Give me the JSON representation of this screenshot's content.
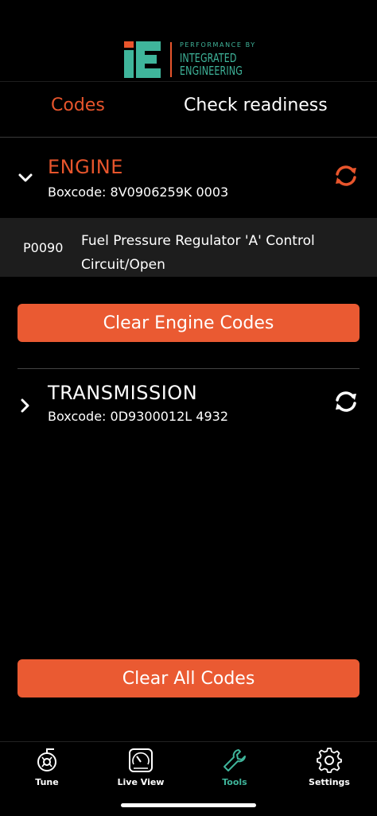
{
  "brand": {
    "tagline": "PERFORMANCE BY",
    "name_line1": "INTEGRATED",
    "name_line2": "ENGINEERING",
    "accent_color": "#e8552c",
    "brand_color": "#3fb59b"
  },
  "tabs": [
    {
      "label": "Codes",
      "active": true
    },
    {
      "label": "Check readiness",
      "active": false
    }
  ],
  "engine": {
    "title": "ENGINE",
    "boxcode": "Boxcode: 8V0906259K  0003",
    "expanded": true,
    "codes": [
      {
        "id": "P0090",
        "description": "Fuel Pressure Regulator 'A' Control Circuit/Open"
      }
    ],
    "clear_label": "Clear Engine Codes"
  },
  "transmission": {
    "title": "TRANSMISSION",
    "boxcode": "Boxcode: 0D9300012L  4932",
    "expanded": false
  },
  "clear_all_label": "Clear All Codes",
  "nav": [
    {
      "label": "Tune",
      "icon": "turbo-icon"
    },
    {
      "label": "Live View",
      "icon": "gauge-icon"
    },
    {
      "label": "Tools",
      "icon": "wrench-icon",
      "active": true
    },
    {
      "label": "Settings",
      "icon": "gear-icon"
    }
  ]
}
